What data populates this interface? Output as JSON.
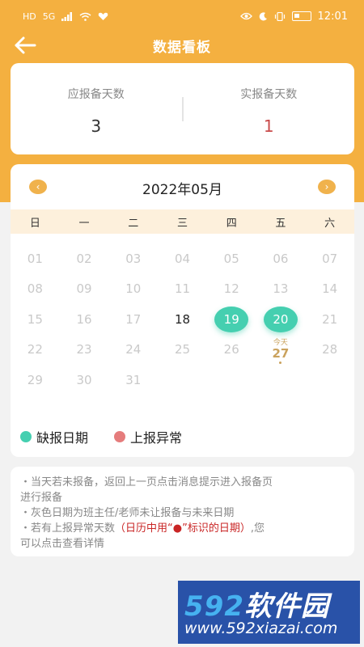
{
  "status_bar": {
    "left_icons": [
      "HD",
      "5G",
      "signal",
      "wifi",
      "heart"
    ],
    "right_icons": [
      "eye",
      "moon",
      "vibrate"
    ],
    "time": "12:01"
  },
  "nav": {
    "title": "数据看板",
    "back_icon": "back-arrow-icon"
  },
  "summary": {
    "due_label": "应报备天数",
    "due_value": "3",
    "actual_label": "实报备天数",
    "actual_value": "1"
  },
  "calendar": {
    "title": "2022年05月",
    "prev_icon": "‹",
    "next_icon": "›",
    "weekdays": [
      "日",
      "一",
      "二",
      "三",
      "四",
      "五",
      "六"
    ],
    "days": [
      {
        "label": "01",
        "state": "disabled"
      },
      {
        "label": "02",
        "state": "disabled"
      },
      {
        "label": "03",
        "state": "disabled"
      },
      {
        "label": "04",
        "state": "disabled"
      },
      {
        "label": "05",
        "state": "disabled"
      },
      {
        "label": "06",
        "state": "disabled"
      },
      {
        "label": "07",
        "state": "disabled"
      },
      {
        "label": "08",
        "state": "disabled"
      },
      {
        "label": "09",
        "state": "disabled"
      },
      {
        "label": "10",
        "state": "disabled"
      },
      {
        "label": "11",
        "state": "disabled"
      },
      {
        "label": "12",
        "state": "disabled"
      },
      {
        "label": "13",
        "state": "disabled"
      },
      {
        "label": "14",
        "state": "disabled"
      },
      {
        "label": "15",
        "state": "disabled"
      },
      {
        "label": "16",
        "state": "disabled"
      },
      {
        "label": "17",
        "state": "disabled"
      },
      {
        "label": "18",
        "state": "normal"
      },
      {
        "label": "19",
        "state": "missed"
      },
      {
        "label": "20",
        "state": "missed"
      },
      {
        "label": "21",
        "state": "disabled"
      },
      {
        "label": "22",
        "state": "disabled"
      },
      {
        "label": "23",
        "state": "disabled"
      },
      {
        "label": "24",
        "state": "disabled"
      },
      {
        "label": "25",
        "state": "disabled"
      },
      {
        "label": "26",
        "state": "disabled"
      },
      {
        "label": "27",
        "state": "today",
        "today_label": "今天"
      },
      {
        "label": "28",
        "state": "disabled"
      },
      {
        "label": "29",
        "state": "disabled"
      },
      {
        "label": "30",
        "state": "disabled"
      },
      {
        "label": "31",
        "state": "disabled"
      }
    ]
  },
  "legend": {
    "missed_label": "缺报日期",
    "missed_color": "#45cfb0",
    "abnormal_label": "上报异常",
    "abnormal_color": "#e57c7c"
  },
  "tips": {
    "line1": "・当天若未报备，返回上一页点击消息提示进入报备页",
    "line2": "进行报备",
    "line3": "・灰色日期为班主任/老师未让报备与未来日期",
    "line4_prefix": "・若有上报异常天数",
    "line4_highlight": "（日历中用“●”标识的日期）",
    "line4_suffix": ",您",
    "line5": "可以点击查看详情"
  },
  "watermark": {
    "line1_num": "592",
    "line1_text": "软件园",
    "line2": "www.592xiazai.com"
  },
  "colors": {
    "accent": "#f4b040",
    "missed": "#45cfb0",
    "abnormal": "#e57c7c",
    "today": "#caa25d"
  }
}
